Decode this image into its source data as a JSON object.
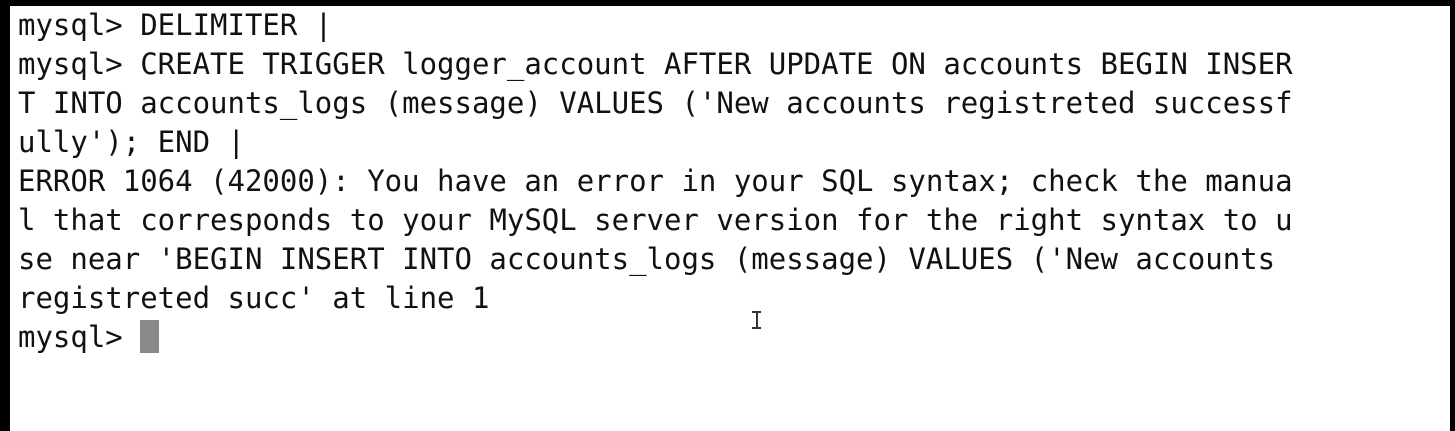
{
  "terminal": {
    "lines": [
      "mysql> DELIMITER |",
      "mysql> CREATE TRIGGER logger_account AFTER UPDATE ON accounts BEGIN INSER",
      "T INTO accounts_logs (message) VALUES ('New accounts registreted successf",
      "ully'); END |",
      "ERROR 1064 (42000): You have an error in your SQL syntax; check the manua",
      "l that corresponds to your MySQL server version for the right syntax to u",
      "se near 'BEGIN INSERT INTO accounts_logs (message) VALUES ('New accounts ",
      "registreted succ' at line 1"
    ],
    "prompt": "mysql> "
  },
  "colors": {
    "background": "#ffffff",
    "text": "#111111",
    "cursor": "#8a8a8a",
    "frame": "#000000"
  },
  "icons": {
    "mouse_pointer": "text-cursor-ibeam-icon",
    "input_cursor": "block-cursor"
  }
}
